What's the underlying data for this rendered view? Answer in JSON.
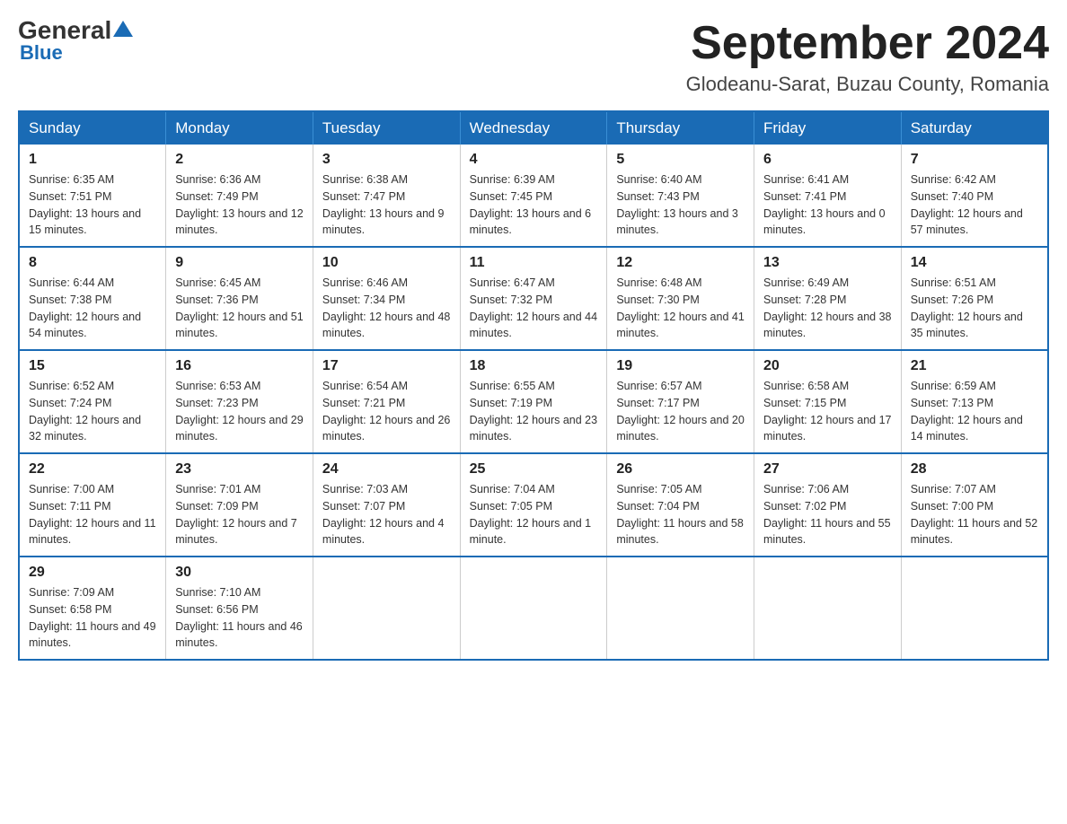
{
  "header": {
    "logo_general": "General",
    "logo_blue": "Blue",
    "month_title": "September 2024",
    "location": "Glodeanu-Sarat, Buzau County, Romania"
  },
  "days_of_week": [
    "Sunday",
    "Monday",
    "Tuesday",
    "Wednesday",
    "Thursday",
    "Friday",
    "Saturday"
  ],
  "weeks": [
    [
      {
        "day": "1",
        "sunrise": "Sunrise: 6:35 AM",
        "sunset": "Sunset: 7:51 PM",
        "daylight": "Daylight: 13 hours and 15 minutes."
      },
      {
        "day": "2",
        "sunrise": "Sunrise: 6:36 AM",
        "sunset": "Sunset: 7:49 PM",
        "daylight": "Daylight: 13 hours and 12 minutes."
      },
      {
        "day": "3",
        "sunrise": "Sunrise: 6:38 AM",
        "sunset": "Sunset: 7:47 PM",
        "daylight": "Daylight: 13 hours and 9 minutes."
      },
      {
        "day": "4",
        "sunrise": "Sunrise: 6:39 AM",
        "sunset": "Sunset: 7:45 PM",
        "daylight": "Daylight: 13 hours and 6 minutes."
      },
      {
        "day": "5",
        "sunrise": "Sunrise: 6:40 AM",
        "sunset": "Sunset: 7:43 PM",
        "daylight": "Daylight: 13 hours and 3 minutes."
      },
      {
        "day": "6",
        "sunrise": "Sunrise: 6:41 AM",
        "sunset": "Sunset: 7:41 PM",
        "daylight": "Daylight: 13 hours and 0 minutes."
      },
      {
        "day": "7",
        "sunrise": "Sunrise: 6:42 AM",
        "sunset": "Sunset: 7:40 PM",
        "daylight": "Daylight: 12 hours and 57 minutes."
      }
    ],
    [
      {
        "day": "8",
        "sunrise": "Sunrise: 6:44 AM",
        "sunset": "Sunset: 7:38 PM",
        "daylight": "Daylight: 12 hours and 54 minutes."
      },
      {
        "day": "9",
        "sunrise": "Sunrise: 6:45 AM",
        "sunset": "Sunset: 7:36 PM",
        "daylight": "Daylight: 12 hours and 51 minutes."
      },
      {
        "day": "10",
        "sunrise": "Sunrise: 6:46 AM",
        "sunset": "Sunset: 7:34 PM",
        "daylight": "Daylight: 12 hours and 48 minutes."
      },
      {
        "day": "11",
        "sunrise": "Sunrise: 6:47 AM",
        "sunset": "Sunset: 7:32 PM",
        "daylight": "Daylight: 12 hours and 44 minutes."
      },
      {
        "day": "12",
        "sunrise": "Sunrise: 6:48 AM",
        "sunset": "Sunset: 7:30 PM",
        "daylight": "Daylight: 12 hours and 41 minutes."
      },
      {
        "day": "13",
        "sunrise": "Sunrise: 6:49 AM",
        "sunset": "Sunset: 7:28 PM",
        "daylight": "Daylight: 12 hours and 38 minutes."
      },
      {
        "day": "14",
        "sunrise": "Sunrise: 6:51 AM",
        "sunset": "Sunset: 7:26 PM",
        "daylight": "Daylight: 12 hours and 35 minutes."
      }
    ],
    [
      {
        "day": "15",
        "sunrise": "Sunrise: 6:52 AM",
        "sunset": "Sunset: 7:24 PM",
        "daylight": "Daylight: 12 hours and 32 minutes."
      },
      {
        "day": "16",
        "sunrise": "Sunrise: 6:53 AM",
        "sunset": "Sunset: 7:23 PM",
        "daylight": "Daylight: 12 hours and 29 minutes."
      },
      {
        "day": "17",
        "sunrise": "Sunrise: 6:54 AM",
        "sunset": "Sunset: 7:21 PM",
        "daylight": "Daylight: 12 hours and 26 minutes."
      },
      {
        "day": "18",
        "sunrise": "Sunrise: 6:55 AM",
        "sunset": "Sunset: 7:19 PM",
        "daylight": "Daylight: 12 hours and 23 minutes."
      },
      {
        "day": "19",
        "sunrise": "Sunrise: 6:57 AM",
        "sunset": "Sunset: 7:17 PM",
        "daylight": "Daylight: 12 hours and 20 minutes."
      },
      {
        "day": "20",
        "sunrise": "Sunrise: 6:58 AM",
        "sunset": "Sunset: 7:15 PM",
        "daylight": "Daylight: 12 hours and 17 minutes."
      },
      {
        "day": "21",
        "sunrise": "Sunrise: 6:59 AM",
        "sunset": "Sunset: 7:13 PM",
        "daylight": "Daylight: 12 hours and 14 minutes."
      }
    ],
    [
      {
        "day": "22",
        "sunrise": "Sunrise: 7:00 AM",
        "sunset": "Sunset: 7:11 PM",
        "daylight": "Daylight: 12 hours and 11 minutes."
      },
      {
        "day": "23",
        "sunrise": "Sunrise: 7:01 AM",
        "sunset": "Sunset: 7:09 PM",
        "daylight": "Daylight: 12 hours and 7 minutes."
      },
      {
        "day": "24",
        "sunrise": "Sunrise: 7:03 AM",
        "sunset": "Sunset: 7:07 PM",
        "daylight": "Daylight: 12 hours and 4 minutes."
      },
      {
        "day": "25",
        "sunrise": "Sunrise: 7:04 AM",
        "sunset": "Sunset: 7:05 PM",
        "daylight": "Daylight: 12 hours and 1 minute."
      },
      {
        "day": "26",
        "sunrise": "Sunrise: 7:05 AM",
        "sunset": "Sunset: 7:04 PM",
        "daylight": "Daylight: 11 hours and 58 minutes."
      },
      {
        "day": "27",
        "sunrise": "Sunrise: 7:06 AM",
        "sunset": "Sunset: 7:02 PM",
        "daylight": "Daylight: 11 hours and 55 minutes."
      },
      {
        "day": "28",
        "sunrise": "Sunrise: 7:07 AM",
        "sunset": "Sunset: 7:00 PM",
        "daylight": "Daylight: 11 hours and 52 minutes."
      }
    ],
    [
      {
        "day": "29",
        "sunrise": "Sunrise: 7:09 AM",
        "sunset": "Sunset: 6:58 PM",
        "daylight": "Daylight: 11 hours and 49 minutes."
      },
      {
        "day": "30",
        "sunrise": "Sunrise: 7:10 AM",
        "sunset": "Sunset: 6:56 PM",
        "daylight": "Daylight: 11 hours and 46 minutes."
      },
      null,
      null,
      null,
      null,
      null
    ]
  ]
}
